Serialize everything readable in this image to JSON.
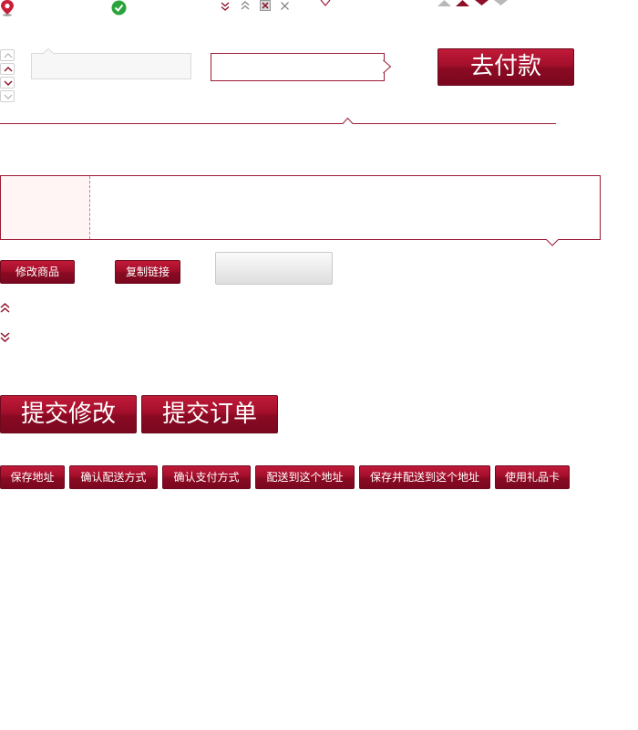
{
  "colors": {
    "brand": "#a30f2b",
    "border_red": "#9b1a35",
    "ok_green": "#2aa33b",
    "grey": "#bfbfbf"
  },
  "icons": {
    "row": [
      "location-pin-icon",
      "check-circle-icon",
      "double-chevron-down-icon",
      "double-chevron-up-icon",
      "close-box-icon",
      "close-icon",
      "chevron-down-icon",
      "triangle-up-icons"
    ]
  },
  "pay_button": {
    "label": "去付款"
  },
  "product_buttons": {
    "modify": "修改商品",
    "copy_link": "复制链接"
  },
  "big_buttons": {
    "submit_changes": "提交修改",
    "submit_order": "提交订单"
  },
  "action_buttons": [
    {
      "label": "保存地址"
    },
    {
      "label": "确认配送方式"
    },
    {
      "label": "确认支付方式"
    },
    {
      "label": "配送到这个地址"
    },
    {
      "label": "保存并配送到这个地址"
    },
    {
      "label": "使用礼品卡"
    }
  ]
}
